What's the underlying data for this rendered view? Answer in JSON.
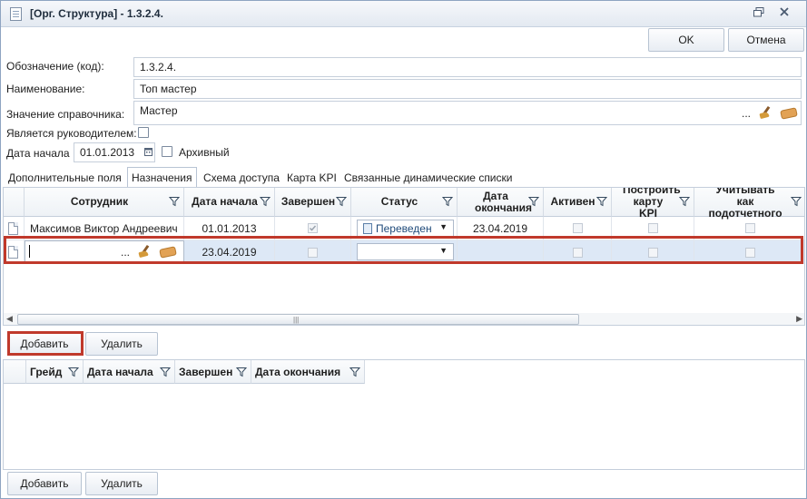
{
  "window": {
    "title": "[Орг. Структура] - 1.3.2.4."
  },
  "toolbar": {
    "ok_label": "OK",
    "cancel_label": "Отмена"
  },
  "form": {
    "code_label": "Обозначение (код):",
    "code_value": "1.3.2.4.",
    "name_label": "Наименование:",
    "name_value": "Топ мастер",
    "dict_label": "Значение справочника:",
    "dict_value": "Мастер",
    "dict_ellipsis": "...",
    "head_label": "Является руководителем:",
    "head_checked": false,
    "date_label": "Дата начала",
    "date_value": "01.01.2013",
    "archived_label": "Архивный",
    "archived_checked": false
  },
  "tabs": [
    {
      "label": "Дополнительные поля",
      "active": false
    },
    {
      "label": "Назначения",
      "active": true
    },
    {
      "label": "Схема доступа",
      "active": false
    },
    {
      "label": "Карта KPI",
      "active": false
    },
    {
      "label": "Связанные динамические списки",
      "active": false
    }
  ],
  "grid": {
    "columns": [
      "Сотрудник",
      "Дата начала",
      "Завершен",
      "Статус",
      "Дата окончания",
      "Активен",
      "Построить карту KPI",
      "Учитывать как подотчетного"
    ],
    "rows": [
      {
        "employee": "Максимов Виктор Андреевич",
        "start": "01.01.2013",
        "completed": true,
        "status": "Переведен",
        "end": "23.04.2019",
        "active": false,
        "kpi": false,
        "subordinate": false
      },
      {
        "employee": "",
        "employee_ellipsis": "...",
        "start": "23.04.2019",
        "completed": false,
        "status": "",
        "end": "",
        "active": false,
        "kpi": false,
        "subordinate": false,
        "selected": true
      }
    ],
    "add_label": "Добавить",
    "delete_label": "Удалить"
  },
  "lower_grid": {
    "columns": [
      "Грейд",
      "Дата начала",
      "Завершен",
      "Дата окончания"
    ],
    "add_label": "Добавить",
    "delete_label": "Удалить"
  },
  "colors": {
    "selected_row": "#dde8f6",
    "highlight": "#c0392b",
    "header_bg": "#eef2f6"
  }
}
